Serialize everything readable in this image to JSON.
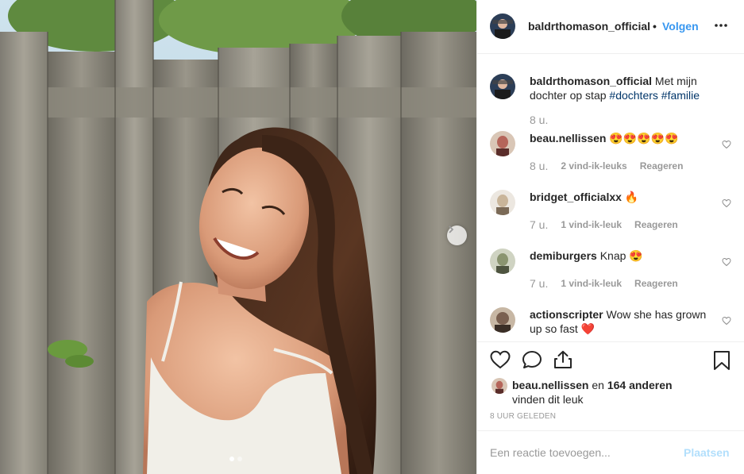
{
  "post": {
    "author": "baldrthomason_official",
    "follow_separator": "•",
    "follow_label": "Volgen",
    "more_label": "•••",
    "caption": {
      "user": "baldrthomason_official",
      "text": " Met mijn dochter op stap ",
      "tags": [
        "#dochters",
        "#familie"
      ],
      "time": "8 u."
    },
    "carousel": {
      "total": 2,
      "current": 1
    }
  },
  "comments": [
    {
      "user": "beau.nellissen",
      "text": " 😍😍😍😍😍",
      "time": "8 u.",
      "likes": "2 vind-ik-leuks",
      "reply": "Reageren",
      "avatar_color": "#b5655a"
    },
    {
      "user": "bridget_officialxx",
      "text": " 🔥",
      "time": "7 u.",
      "likes": "1 vind-ik-leuk",
      "reply": "Reageren",
      "avatar_color": "#c9b59a"
    },
    {
      "user": "demiburgers",
      "text": " Knap 😍",
      "time": "7 u.",
      "likes": "1 vind-ik-leuk",
      "reply": "Reageren",
      "avatar_color": "#8a9470"
    },
    {
      "user": "actionscripter",
      "text": " Wow she has grown up so fast ❤️",
      "time": "",
      "likes": "",
      "reply": "",
      "avatar_color": "#7a6050"
    }
  ],
  "likes_summary": {
    "user": "beau.nellissen",
    "connector": " en ",
    "others": "164 anderen",
    "suffix": "vinden dit leuk"
  },
  "timestamp": "8 uur geleden",
  "comment_input": {
    "placeholder": "Een reactie toevoegen...",
    "post_label": "Plaatsen"
  },
  "colors": {
    "accent": "#3897f0",
    "post_disabled": "#b2dffc",
    "muted": "#999999",
    "text": "#262626"
  },
  "icons": [
    "heart-icon",
    "comment-icon",
    "share-icon",
    "bookmark-icon",
    "chevron-right-icon",
    "more-icon"
  ]
}
